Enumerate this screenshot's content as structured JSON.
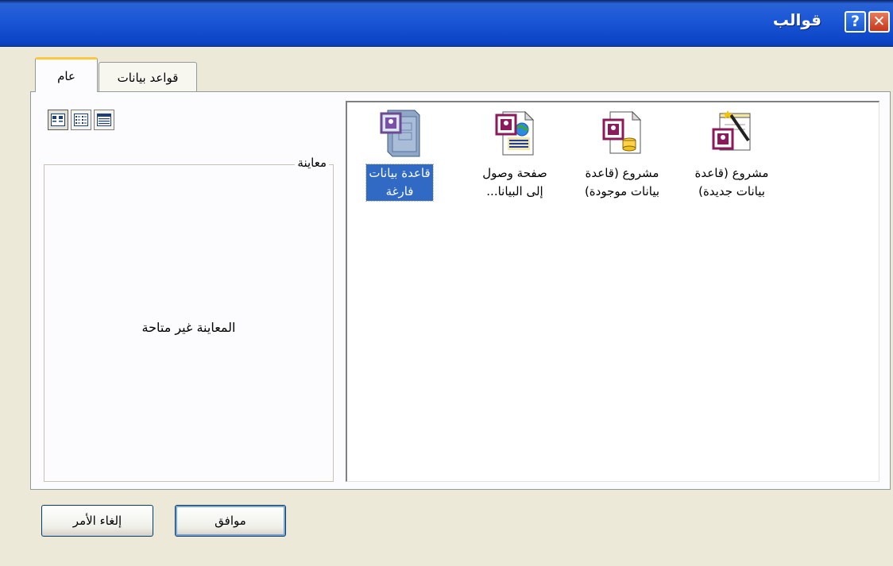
{
  "window": {
    "title": "قوالب"
  },
  "titlebar_buttons": {
    "help": "?",
    "close": "✕"
  },
  "tabs": [
    {
      "label": "عام",
      "selected": true
    },
    {
      "label": "قواعد بيانات",
      "selected": false
    }
  ],
  "view_buttons": [
    {
      "icon": "large-icons-view-icon",
      "pressed": true
    },
    {
      "icon": "list-view-icon",
      "pressed": false
    },
    {
      "icon": "details-view-icon",
      "pressed": false
    }
  ],
  "preview": {
    "label": "معاينة",
    "message": "المعاينة غير متاحة"
  },
  "templates": [
    {
      "label": "مشروع (قاعدة\nبيانات جديدة)",
      "icon": "new-project-icon",
      "selected": false
    },
    {
      "label": "مشروع (قاعدة\nبيانات موجودة)",
      "icon": "existing-project-icon",
      "selected": false
    },
    {
      "label": "صفحة وصول\nإلى البيانا...",
      "icon": "data-access-page-icon",
      "selected": false
    },
    {
      "label": "قاعدة بيانات\nفارغة",
      "icon": "blank-database-icon",
      "selected": true
    }
  ],
  "buttons": {
    "ok": "موافق",
    "cancel": "إلغاء الأمر"
  },
  "colors": {
    "titlebar": "#0d47c8",
    "selection": "#316ac5",
    "dialog_bg": "#ece9d8",
    "access_key": "#8b1a5a"
  }
}
